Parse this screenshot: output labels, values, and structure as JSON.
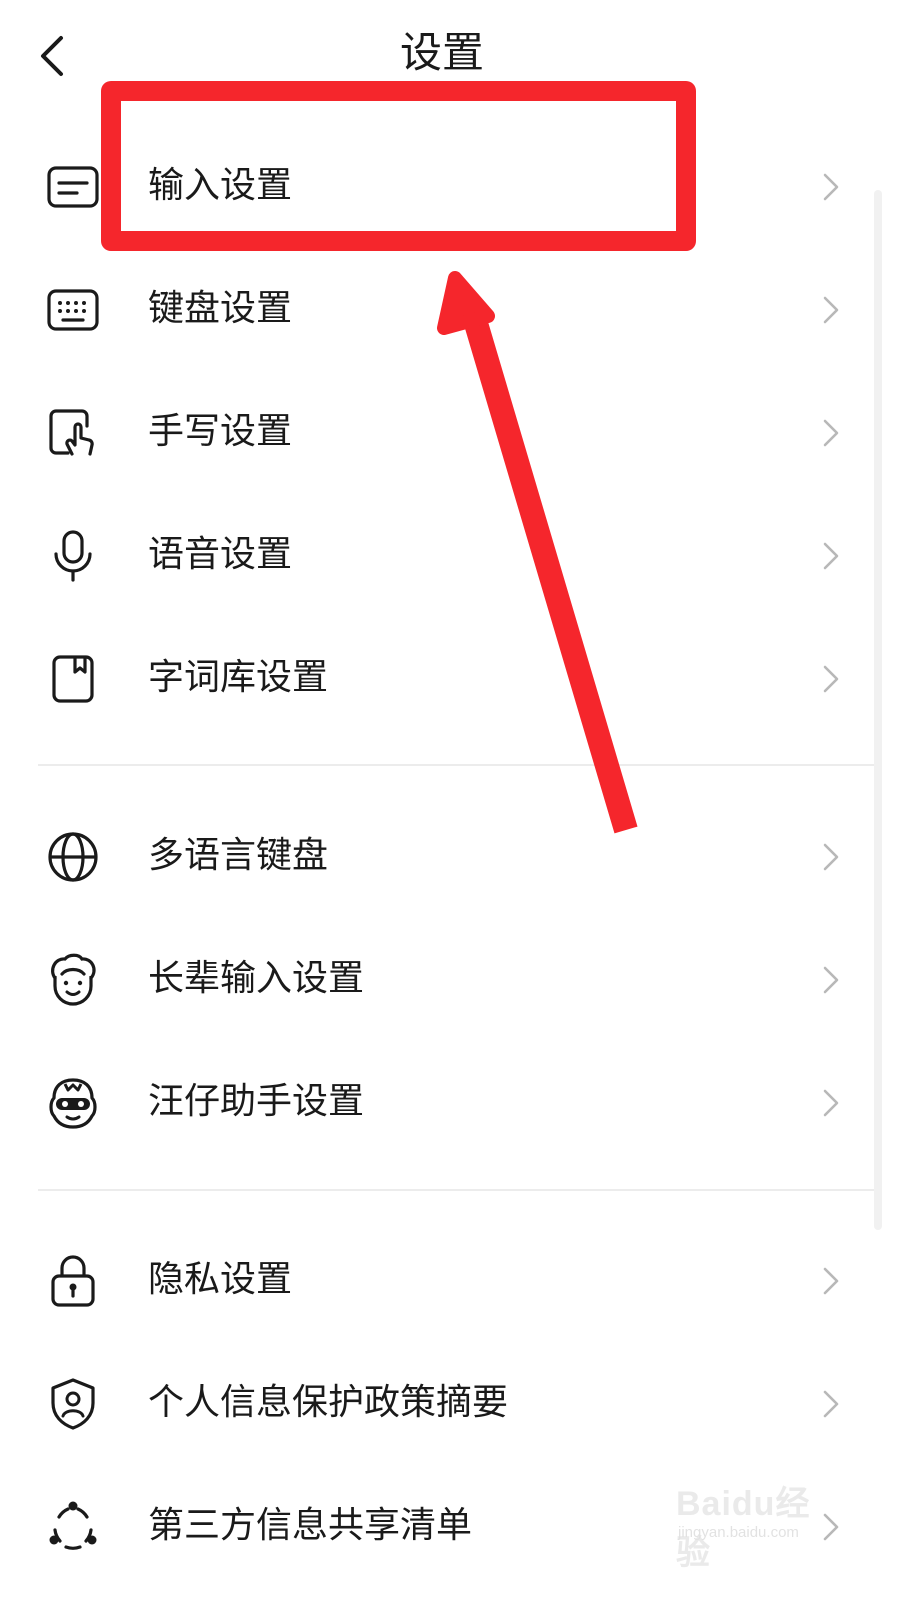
{
  "header": {
    "title": "设置",
    "back_icon": "chevron-left-icon"
  },
  "sections": [
    {
      "items": [
        {
          "label": "输入设置",
          "icon": "input-card-icon"
        },
        {
          "label": "键盘设置",
          "icon": "keyboard-icon"
        },
        {
          "label": "手写设置",
          "icon": "handwriting-icon"
        },
        {
          "label": "语音设置",
          "icon": "microphone-icon"
        },
        {
          "label": "字词库设置",
          "icon": "dictionary-book-icon"
        }
      ]
    },
    {
      "items": [
        {
          "label": "多语言键盘",
          "icon": "globe-icon"
        },
        {
          "label": "长辈输入设置",
          "icon": "elder-face-icon"
        },
        {
          "label": "汪仔助手设置",
          "icon": "assistant-mascot-icon"
        }
      ]
    },
    {
      "items": [
        {
          "label": "隐私设置",
          "icon": "lock-icon"
        },
        {
          "label": "个人信息保护政策摘要",
          "icon": "shield-user-icon"
        },
        {
          "label": "第三方信息共享清单",
          "icon": "share-nodes-icon"
        }
      ]
    }
  ],
  "row_chevron_icon": "chevron-right-icon",
  "annotation": {
    "highlight_color": "#f5262c",
    "highlighted_item": "输入设置"
  },
  "watermark": {
    "brand": "Baidu经验",
    "url": "jingyan.baidu.com"
  },
  "colors": {
    "background": "#ffffff",
    "text": "#1a1a1a",
    "chevron": "#b8b8b8",
    "divider": "#ececec"
  }
}
